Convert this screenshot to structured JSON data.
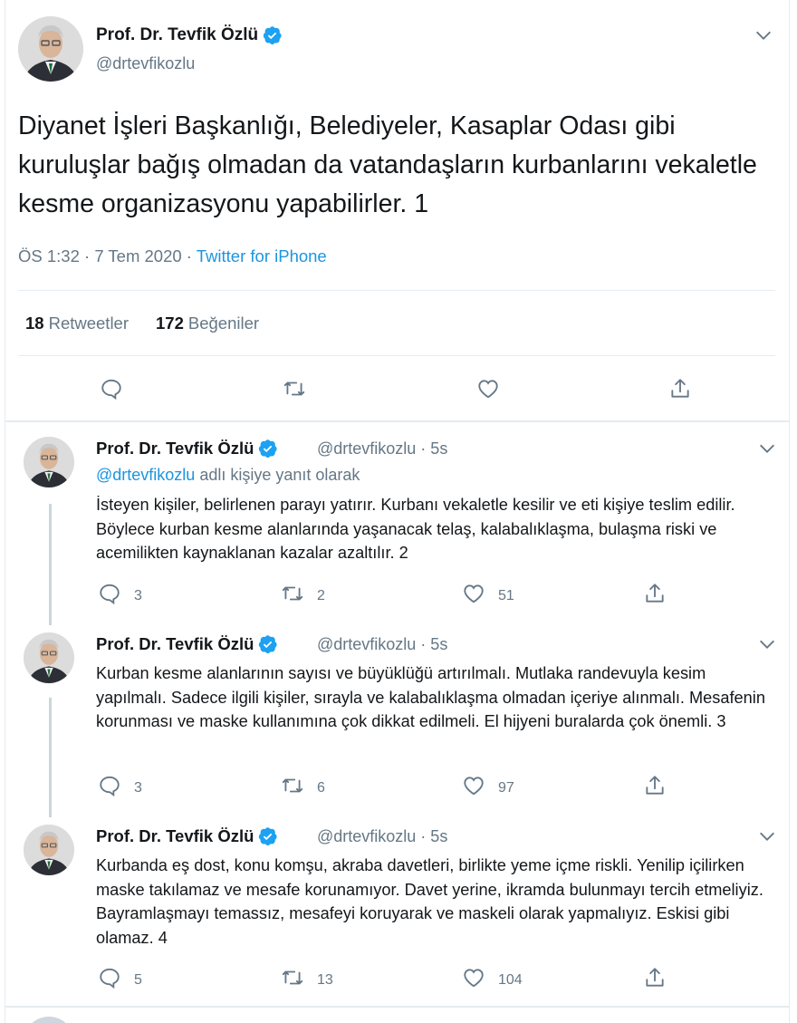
{
  "main_tweet": {
    "author_name": "Prof. Dr. Tevfik Özlü",
    "handle": "@drtevfikozlu",
    "text": "Diyanet İşleri Başkanlığı, Belediyeler, Kasaplar Odası gibi kuruluşlar bağış olmadan da vatandaşların kurbanlarını vekaletle kesme organizasyonu yapabilirler. 1",
    "time": "ÖS 1:32 · 7 Tem 2020",
    "separator": " · ",
    "source": "Twitter for iPhone",
    "retweets_count": "18",
    "retweets_label": "Retweetler",
    "likes_count": "172",
    "likes_label": "Beğeniler"
  },
  "replies": [
    {
      "author_name": "Prof. Dr. Tevfik Özlü",
      "meta": "@drtevfikozlu · 5s",
      "replying_to_handle": "@drtevfikozlu",
      "replying_to_suffix": " adlı kişiye yanıt olarak",
      "text": "İsteyen kişiler, belirlenen parayı yatırır. Kurbanı vekaletle kesilir ve eti kişiye teslim edilir. Böylece kurban kesme alanlarında yaşanacak telaş, kalabalıklaşma, bulaşma riski ve acemilikten kaynaklanan kazalar azaltılır. 2",
      "reply_count": "3",
      "retweet_count": "2",
      "like_count": "51"
    },
    {
      "author_name": "Prof. Dr. Tevfik Özlü",
      "meta": "@drtevfikozlu · 5s",
      "text": "Kurban kesme alanlarının sayısı ve büyüklüğü artırılmalı. Mutlaka randevuyla kesim yapılmalı. Sadece ilgili kişiler, sırayla ve kalabalıklaşma olmadan içeriye alınmalı. Mesafenin korunması ve maske kullanımına çok dikkat edilmeli. El hijyeni buralarda çok önemli. 3",
      "reply_count": "3",
      "retweet_count": "6",
      "like_count": "97"
    },
    {
      "author_name": "Prof. Dr. Tevfik Özlü",
      "meta": "@drtevfikozlu · 5s",
      "text": "Kurbanda eş dost, konu komşu, akraba davetleri, birlikte yeme içme riskli. Yenilip içilirken maske takılamaz ve mesafe korunamıyor. Davet yerine, ikramda bulunmayı tercih etmeliyiz. Bayramlaşmayı temassız, mesafeyi koruyarak ve maskeli olarak yapmalıyız. Eskisi gibi olamaz. 4",
      "reply_count": "5",
      "retweet_count": "13",
      "like_count": "104"
    }
  ],
  "colors": {
    "text": "#14171a",
    "secondary": "#657786",
    "link": "#1b95e0",
    "verified": "#1da1f2",
    "divider": "#e6ecf0",
    "thread_line": "#ccd6dd"
  },
  "icons": [
    "verified-badge-icon",
    "chevron-down-icon",
    "reply-icon",
    "retweet-icon",
    "like-icon",
    "share-icon"
  ]
}
